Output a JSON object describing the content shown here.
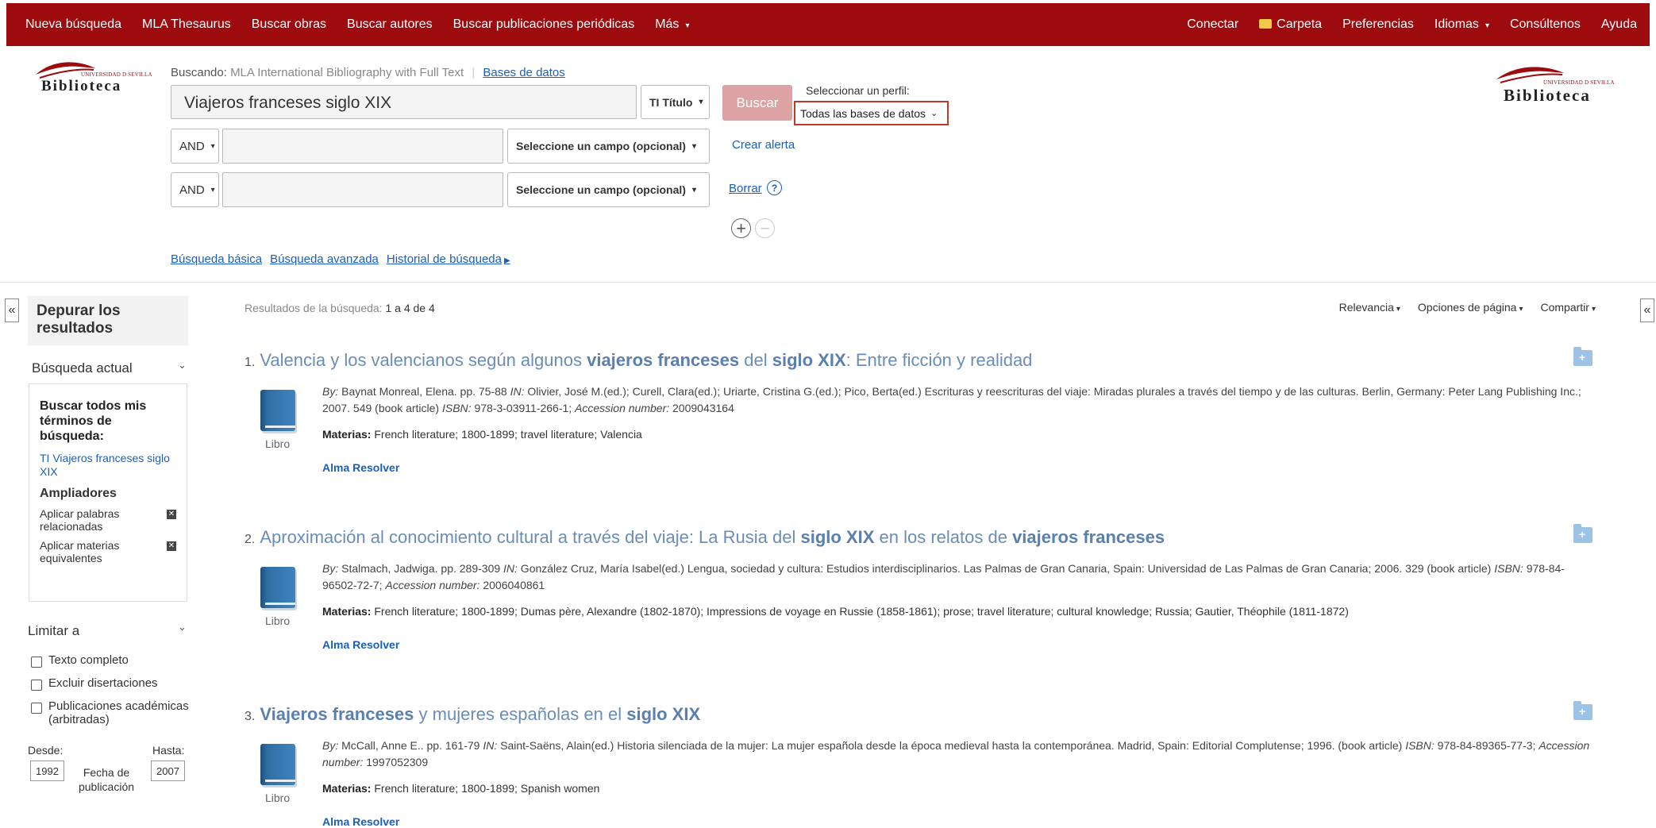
{
  "topbar": {
    "left": [
      "Nueva búsqueda",
      "MLA Thesaurus",
      "Buscar obras",
      "Buscar autores",
      "Buscar publicaciones periódicas",
      "Más"
    ],
    "right": {
      "conectar": "Conectar",
      "carpeta": "Carpeta",
      "preferencias": "Preferencias",
      "idiomas": "Idiomas",
      "consultenos": "Consúltenos",
      "ayuda": "Ayuda"
    }
  },
  "logo": {
    "small": "UNIVERSIDAD D SEVILLA",
    "big": "Biblioteca"
  },
  "search": {
    "searching_label": "Buscando:",
    "database": "MLA International Bibliography with Full Text",
    "db_link": "Bases de datos",
    "query": "Viajeros franceses siglo XIX",
    "field1": "TI Título",
    "op": "AND",
    "field_placeholder": "Seleccione un campo (opcional)",
    "buscar": "Buscar",
    "perfil_label": "Seleccionar un perfil:",
    "perfil_value": "Todas las bases de datos",
    "crear_alerta": "Crear alerta",
    "borrar": "Borrar",
    "help": "?",
    "plus": "+",
    "minus": "−",
    "links": [
      "Búsqueda básica",
      "Búsqueda avanzada",
      "Historial de búsqueda"
    ]
  },
  "sidebar": {
    "collapse": "«",
    "refine": "Depurar los resultados",
    "current": "Búsqueda actual",
    "find_all": "Buscar todos mis términos de búsqueda:",
    "query_link": "TI Viajeros franceses siglo XIX",
    "ampliadores": "Ampliadores",
    "exp1": "Aplicar palabras relacionadas",
    "exp2": "Aplicar materias equivalentes",
    "limit": "Limitar a",
    "limits": [
      "Texto completo",
      "Excluir disertaciones",
      "Publicaciones académicas (arbitradas)"
    ],
    "desde": "Desde:",
    "hasta": "Hasta:",
    "year_from": "1992",
    "year_to": "2007",
    "fecha": "Fecha de publicación"
  },
  "results": {
    "count_label": "Resultados de la búsqueda:",
    "count_value": "1 a 4 de 4",
    "sort": [
      "Relevancia",
      "Opciones de página",
      "Compartir"
    ],
    "items": [
      {
        "num": "1.",
        "title_parts": [
          [
            "Valencia y los valencianos según algunos ",
            false
          ],
          [
            "viajeros franceses",
            true
          ],
          [
            " del ",
            false
          ],
          [
            "siglo XIX",
            true
          ],
          [
            ": Entre ficción y realidad",
            false
          ]
        ],
        "by": "By:",
        "meta1": " Baynat Monreal, Elena. pp. 75-88 ",
        "in": "IN:",
        "meta2": " Olivier, José M.(ed.); Curell, Clara(ed.); Uriarte, Cristina G.(ed.); Pico, Berta(ed.) Escrituras y reescrituras del viaje: Miradas plurales a través del tiempo y de las culturas. Berlin, Germany: Peter Lang Publishing Inc.; 2007. 549 (book article) ",
        "isbn_label": "ISBN:",
        "isbn": " 978-3-03911-266-1; ",
        "acc_label": "Accession number:",
        "acc": " 2009043164",
        "materias_label": "Materias:",
        "materias": "French literature; 1800-1899; travel literature; Valencia",
        "type": "Libro",
        "alma": "Alma Resolver"
      },
      {
        "num": "2.",
        "title_parts": [
          [
            "Aproximación al conocimiento cultural a través del viaje: La Rusia del ",
            false
          ],
          [
            "siglo XIX",
            true
          ],
          [
            " en los relatos de ",
            false
          ],
          [
            "viajeros franceses",
            true
          ]
        ],
        "by": "By:",
        "meta1": " Stalmach, Jadwiga. pp. 289-309 ",
        "in": "IN:",
        "meta2": " González Cruz, María Isabel(ed.) Lengua, sociedad y cultura: Estudios interdisciplinarios. Las Palmas de Gran Canaria, Spain: Universidad de Las Palmas de Gran Canaria; 2006. 329 (book article) ",
        "isbn_label": "ISBN:",
        "isbn": " 978-84-96502-72-7; ",
        "acc_label": "Accession number:",
        "acc": " 2006040861",
        "materias_label": "Materias:",
        "materias": "French literature; 1800-1899; Dumas père, Alexandre (1802-1870); Impressions de voyage en Russie (1858-1861); prose; travel literature; cultural knowledge; Russia; Gautier, Théophile (1811-1872)",
        "type": "Libro",
        "alma": "Alma Resolver"
      },
      {
        "num": "3.",
        "title_parts": [
          [
            "Viajeros franceses",
            true
          ],
          [
            " y mujeres españolas en el ",
            false
          ],
          [
            "siglo XIX",
            true
          ]
        ],
        "by": "By:",
        "meta1": " McCall, Anne E.. pp. 161-79 ",
        "in": "IN:",
        "meta2": " Saint-Saëns, Alain(ed.) Historia silenciada de la mujer: La mujer española desde la época medieval hasta la contemporánea. Madrid, Spain: Editorial Complutense; 1996. (book article) ",
        "isbn_label": "ISBN:",
        "isbn": " 978-84-89365-77-3; ",
        "acc_label": "Accession number:",
        "acc": " 1997052309",
        "materias_label": "Materias:",
        "materias": "French literature; 1800-1899; Spanish women",
        "type": "Libro",
        "alma": "Alma Resolver"
      }
    ]
  },
  "colors": {
    "brand": "#9e0b0f",
    "link": "#1a5fbf",
    "title": "#6a8db8"
  }
}
